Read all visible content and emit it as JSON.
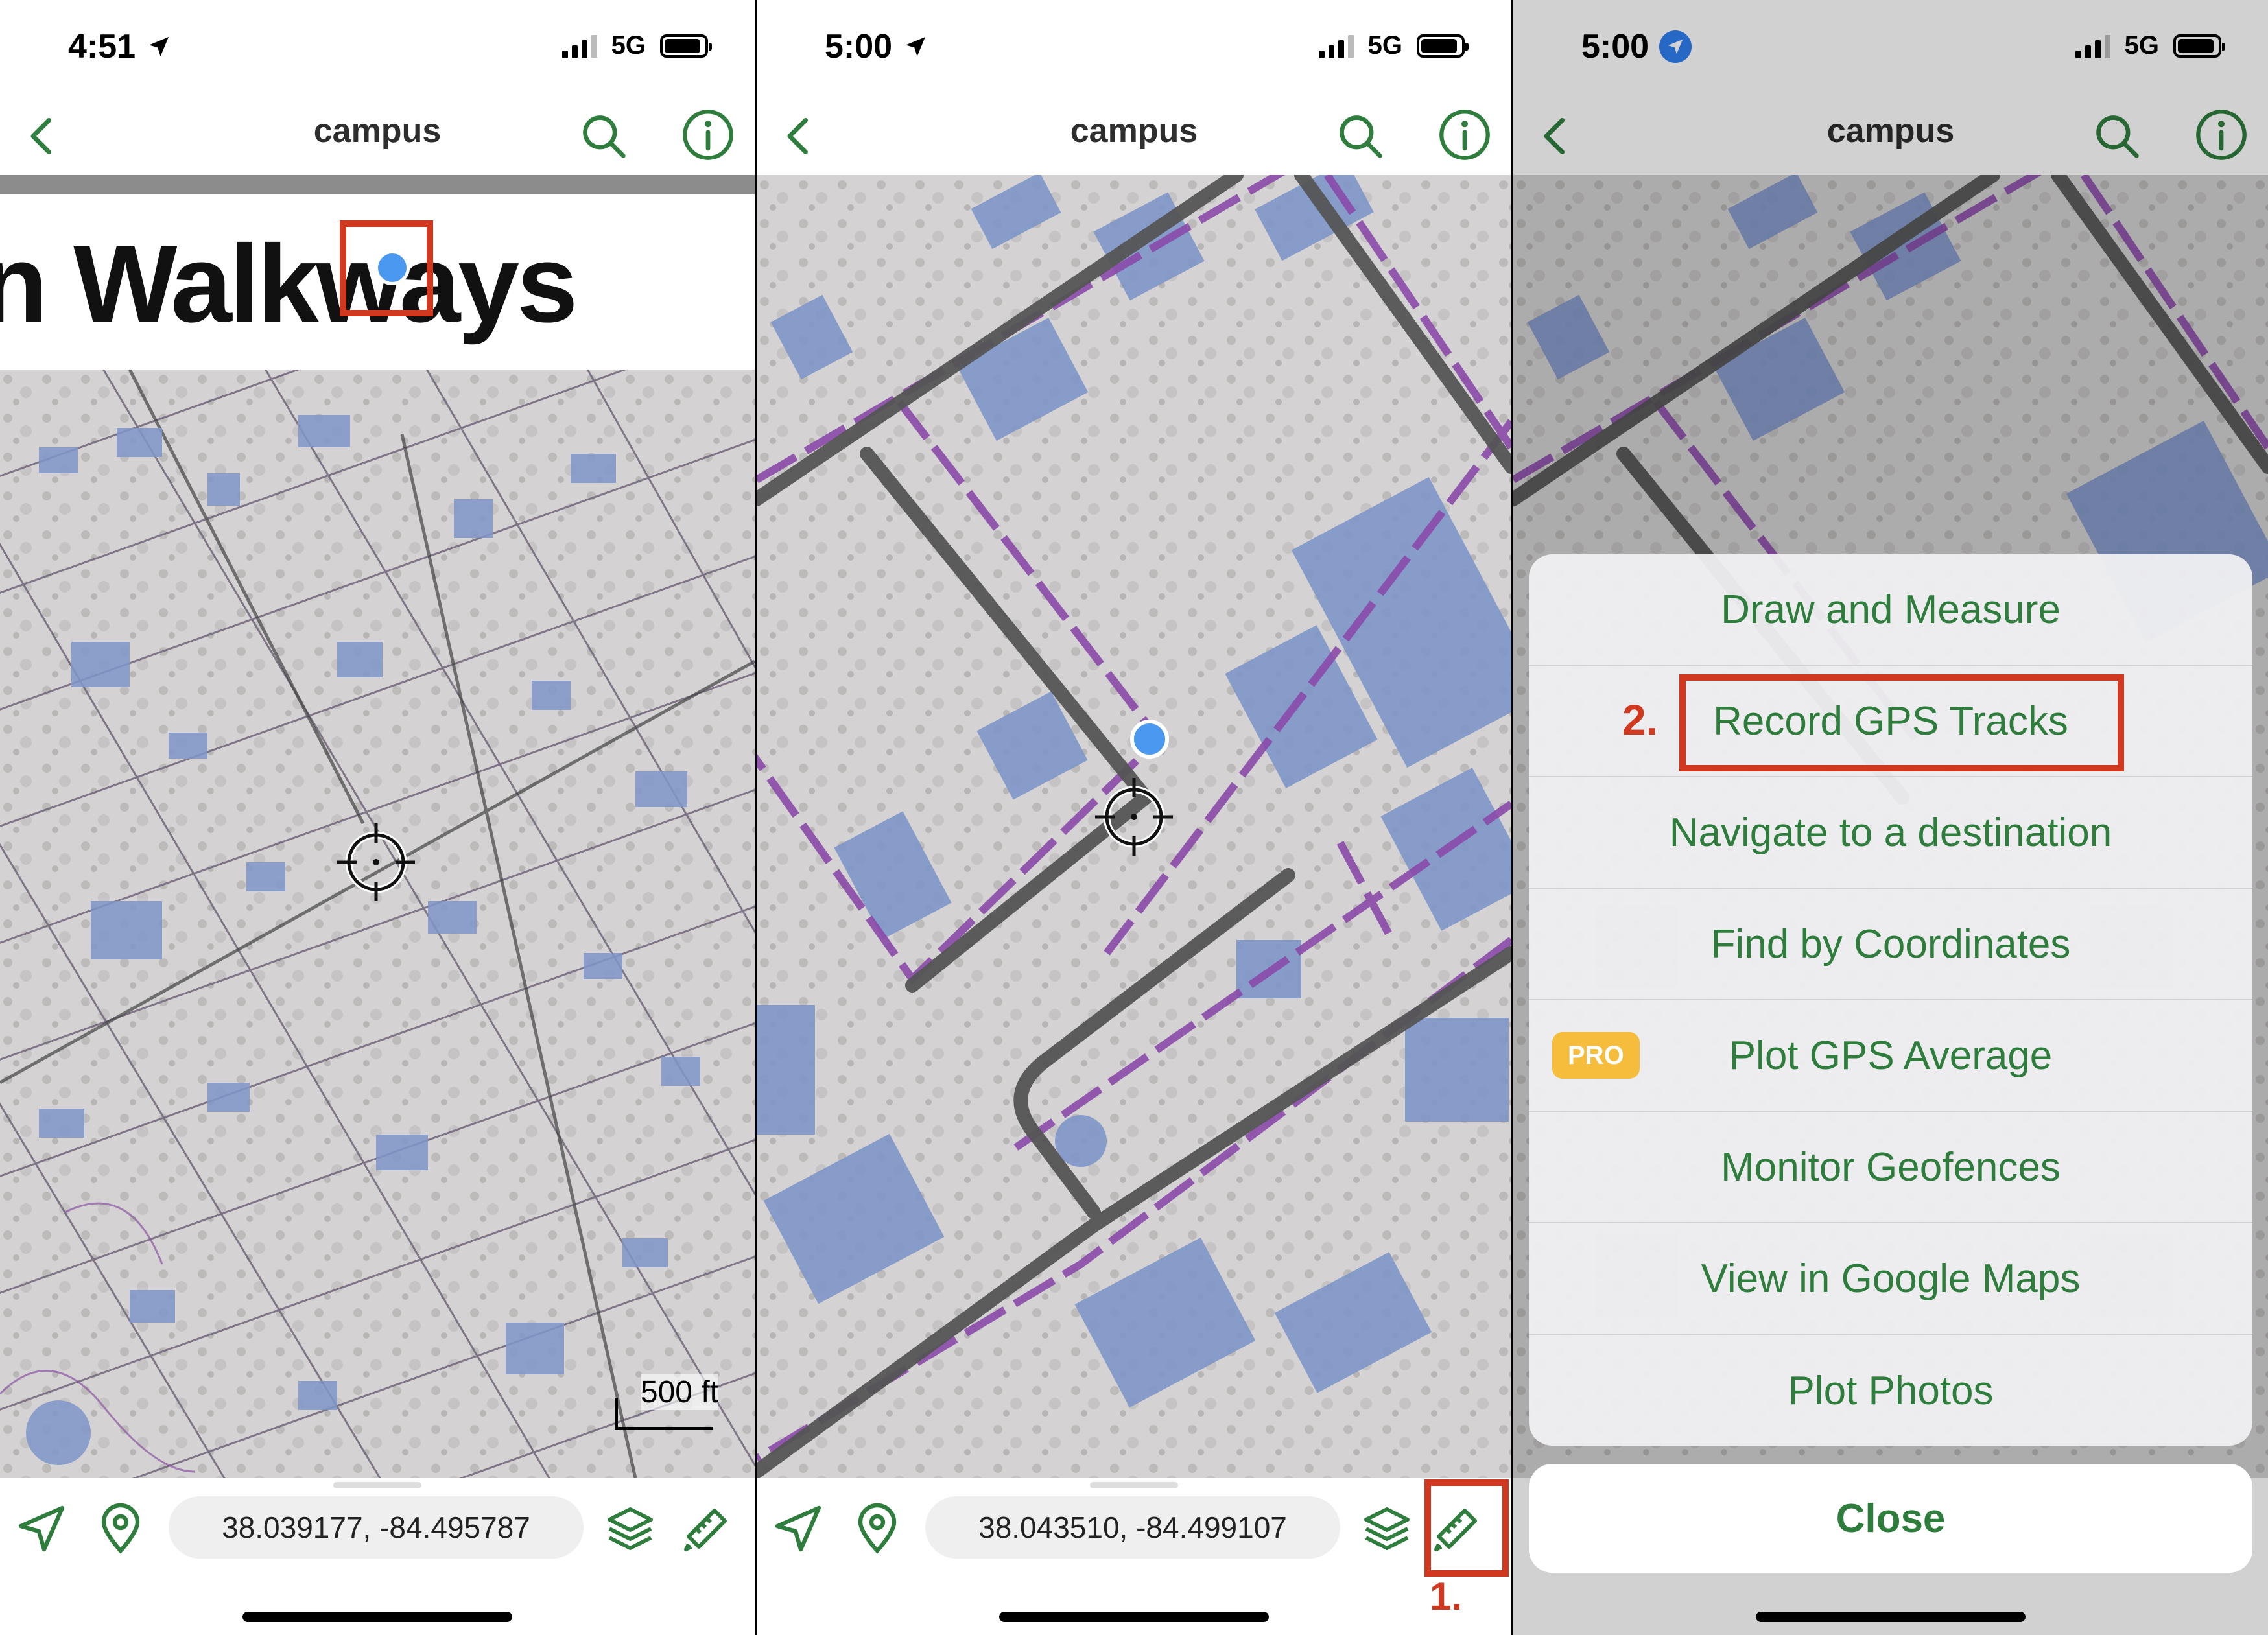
{
  "panels": [
    {
      "status": {
        "time": "4:51",
        "network": "5G"
      },
      "nav": {
        "title": "campus"
      },
      "map": {
        "banner_text": "n Walkways",
        "scale_label": "500 ft"
      },
      "toolbar": {
        "coords": "38.039177, -84.495787"
      }
    },
    {
      "status": {
        "time": "5:00",
        "network": "5G"
      },
      "nav": {
        "title": "campus"
      },
      "toolbar": {
        "coords": "38.043510, -84.499107"
      },
      "annotation": {
        "step": "1."
      }
    },
    {
      "status": {
        "time": "5:00",
        "network": "5G"
      },
      "nav": {
        "title": "campus"
      },
      "menu": {
        "items": [
          {
            "label": "Draw and Measure"
          },
          {
            "label": "Record GPS Tracks"
          },
          {
            "label": "Navigate to a destination"
          },
          {
            "label": "Find by Coordinates"
          },
          {
            "label": "Plot GPS Average",
            "badge": "PRO"
          },
          {
            "label": "Monitor Geofences"
          },
          {
            "label": "View in Google Maps"
          },
          {
            "label": "Plot Photos"
          }
        ],
        "close_label": "Close"
      },
      "annotation": {
        "step": "2."
      }
    }
  ],
  "colors": {
    "accent_green": "#2f7d3d",
    "annotation_red": "#d0391f",
    "pro_badge": "#f6bd3c",
    "building_blue": "#7f96c9",
    "path_purple": "#8a55a3",
    "road_gray": "#555555"
  },
  "icons": [
    "location-arrow-icon",
    "back-chevron-icon",
    "search-icon",
    "info-icon",
    "crosshair-icon",
    "map-pin-icon",
    "layers-icon",
    "ruler-pencil-icon",
    "user-location-dot-icon"
  ]
}
